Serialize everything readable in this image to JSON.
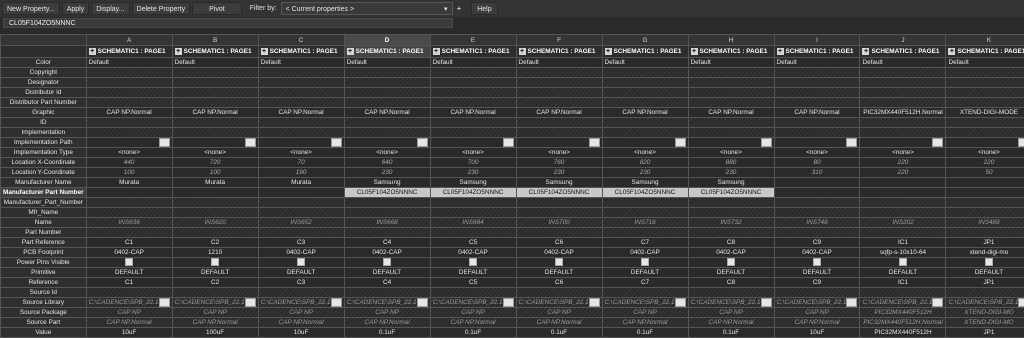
{
  "toolbar": {
    "new_property": "New Property...",
    "apply": "Apply",
    "display": "Display...",
    "delete_property": "Delete Property",
    "pivot": "Pivot",
    "filter_label": "Filter by:",
    "filter_value": "< Current properties >",
    "plus": "+",
    "help": "Help"
  },
  "value_bar": "CL05F104ZO5NNNC",
  "columns": [
    {
      "letter": "A",
      "header": "SCHEMATIC1 : PAGE1"
    },
    {
      "letter": "B",
      "header": "SCHEMATIC1 : PAGE1"
    },
    {
      "letter": "C",
      "header": "SCHEMATIC1 : PAGE1"
    },
    {
      "letter": "D",
      "header": "SCHEMATIC1 : PAGE1"
    },
    {
      "letter": "E",
      "header": "SCHEMATIC1 : PAGE1"
    },
    {
      "letter": "F",
      "header": "SCHEMATIC1 : PAGE1"
    },
    {
      "letter": "G",
      "header": "SCHEMATIC1 : PAGE1"
    },
    {
      "letter": "H",
      "header": "SCHEMATIC1 : PAGE1"
    },
    {
      "letter": "I",
      "header": "SCHEMATIC1 : PAGE1"
    },
    {
      "letter": "J",
      "header": "SCHEMATIC1 : PAGE1"
    },
    {
      "letter": "K",
      "header": "SCHEMATIC1 : PAGE1"
    }
  ],
  "rows": {
    "color": {
      "label": "Color",
      "values": [
        "Default",
        "Default",
        "Default",
        "Default",
        "Default",
        "Default",
        "Default",
        "Default",
        "Default",
        "Default",
        "Default"
      ]
    },
    "copyright": {
      "label": "Copyright"
    },
    "designator": {
      "label": "Designator"
    },
    "distributor_id": {
      "label": "Distributor Id"
    },
    "distributor_part_number": {
      "label": "Distributor Part Number"
    },
    "graphic": {
      "label": "Graphic",
      "values": [
        "CAP NP.Normal",
        "CAP NP.Normal",
        "CAP NP.Normal",
        "CAP NP.Normal",
        "CAP NP.Normal",
        "CAP NP.Normal",
        "CAP NP.Normal",
        "CAP NP.Normal",
        "CAP NP.Normal",
        "PIC32MX440F512H.Normal",
        "XTEND-DIGI-MODE"
      ]
    },
    "id": {
      "label": "ID"
    },
    "implementation": {
      "label": "Implementation"
    },
    "implementation_path": {
      "label": "Implementation Path"
    },
    "implementation_type": {
      "label": "Implementation Type",
      "values": [
        "<none>",
        "<none>",
        "<none>",
        "<none>",
        "<none>",
        "<none>",
        "<none>",
        "<none>",
        "<none>",
        "<none>",
        "<none>"
      ]
    },
    "location_x": {
      "label": "Location X-Coordinate",
      "values": [
        "440",
        "720",
        "70",
        "640",
        "700",
        "760",
        "820",
        "880",
        "80",
        "220",
        "220"
      ]
    },
    "location_y": {
      "label": "Location Y-Coordinate",
      "values": [
        "100",
        "100",
        "190",
        "230",
        "230",
        "230",
        "230",
        "230",
        "310",
        "220",
        "50"
      ]
    },
    "manufacturer_name": {
      "label": "Manufacturer Name",
      "values": [
        "Murata",
        "Murata",
        "Murata",
        "Samsung",
        "Samsung",
        "Samsung",
        "Samsung",
        "Samsung",
        "",
        "",
        ""
      ]
    },
    "manufacturer_part_number": {
      "label": "Manufacturer Part Number",
      "values": [
        "",
        "",
        "",
        "CL05F104ZO5NNNC",
        "CL05F104ZO5NNNC",
        "CL05F104ZO5NNNC",
        "CL05F104ZO5NNNC",
        "CL05F104ZO5NNNC",
        "",
        "",
        ""
      ]
    },
    "manufacturer_part_number2": {
      "label": "Manufacturer_Part_Number"
    },
    "mfr_name": {
      "label": "Mfr_Name"
    },
    "name": {
      "label": "Name",
      "values": [
        "INS636",
        "INS620",
        "INS652",
        "INS668",
        "INS684",
        "INS700",
        "INS716",
        "INS732",
        "INS748",
        "INS202",
        "INS489"
      ]
    },
    "part_number": {
      "label": "Part Number"
    },
    "part_reference": {
      "label": "Part Reference",
      "values": [
        "C1",
        "C2",
        "C3",
        "C4",
        "C5",
        "C6",
        "C7",
        "C8",
        "C9",
        "IC1",
        "JP1"
      ]
    },
    "pcb_footprint": {
      "label": "PCB Footprint",
      "values": [
        "0402-CAP",
        "1210",
        "0402-CAP",
        "0402-CAP",
        "0402-CAP",
        "0402-CAP",
        "0402-CAP",
        "0402-CAP",
        "0402-CAP",
        "sqfp-s-10x10-64",
        "xtend-digi-mo"
      ]
    },
    "power_pins_visible": {
      "label": "Power Pins Visible"
    },
    "primitive": {
      "label": "Primitive",
      "values": [
        "DEFAULT",
        "DEFAULT",
        "DEFAULT",
        "DEFAULT",
        "DEFAULT",
        "DEFAULT",
        "DEFAULT",
        "DEFAULT",
        "DEFAULT",
        "DEFAULT",
        "DEFAULT"
      ]
    },
    "reference": {
      "label": "Reference",
      "values": [
        "C1",
        "C2",
        "C3",
        "C4",
        "C5",
        "C6",
        "C7",
        "C8",
        "C9",
        "IC1",
        "JP1"
      ]
    },
    "source_id": {
      "label": "Source Id"
    },
    "source_library": {
      "label": "Source Library",
      "values": [
        "C:\\CADENCE\\SPB_22.1",
        "C:\\CADENCE\\SPB_22.1",
        "C:\\CADENCE\\SPB_22.1",
        "C:\\CADENCE\\SPB_22.1",
        "C:\\CADENCE\\SPB_22.1",
        "C:\\CADENCE\\SPB_22.1",
        "C:\\CADENCE\\SPB_22.1",
        "C:\\CADENCE\\SPB_22.1",
        "C:\\CADENCE\\SPB_22.1",
        "C:\\CADENCE\\SPB_22.1",
        "C:\\CADENCE\\SPB_22.1"
      ]
    },
    "source_package": {
      "label": "Source Package",
      "values": [
        "CAP NP",
        "CAP NP",
        "CAP NP",
        "CAP NP",
        "CAP NP",
        "CAP NP",
        "CAP NP",
        "CAP NP",
        "CAP NP",
        "PIC32MX440F512H",
        "XTEND-DIGI-MO"
      ]
    },
    "source_part": {
      "label": "Source Part",
      "values": [
        "CAP NP.Normal",
        "CAP NP.Normal",
        "CAP NP.Normal",
        "CAP NP.Normal",
        "CAP NP.Normal",
        "CAP NP.Normal",
        "CAP NP.Normal",
        "CAP NP.Normal",
        "CAP NP.Normal",
        "PIC32MX440F512H.Normal",
        "XTEND-DIGI-MO"
      ]
    },
    "value": {
      "label": "Value",
      "values": [
        "10uF",
        "100uF",
        "10uF",
        "0.1uF",
        "0.1uF",
        "0.1uF",
        "0.1uF",
        "0.1uF",
        "10uF",
        "PIC32MX440F512H",
        "JP1"
      ]
    }
  },
  "expander_symbol": "+",
  "selected_column": "D"
}
